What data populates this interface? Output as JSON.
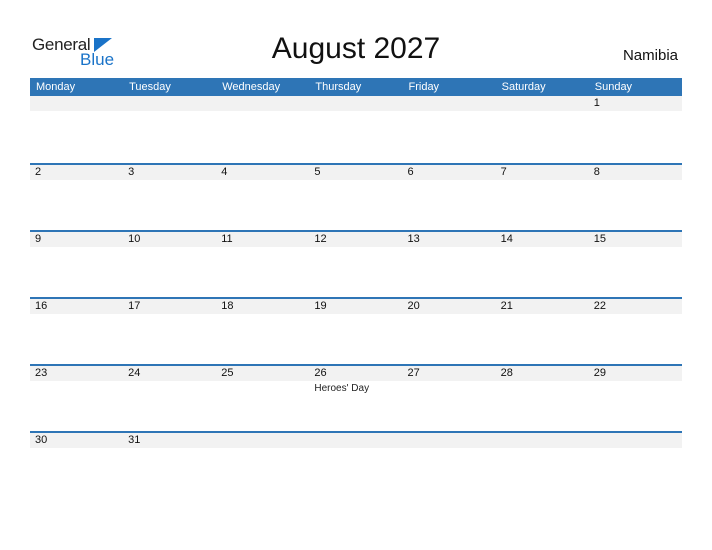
{
  "logo": {
    "word1": "General",
    "word2": "Blue"
  },
  "header": {
    "title": "August 2027",
    "country": "Namibia"
  },
  "colors": {
    "accent": "#2e75b6",
    "row_band": "#f2f2f2",
    "logo_blue": "#1a73c8"
  },
  "weekdays": [
    "Monday",
    "Tuesday",
    "Wednesday",
    "Thursday",
    "Friday",
    "Saturday",
    "Sunday"
  ],
  "weeks": [
    [
      {
        "day": ""
      },
      {
        "day": ""
      },
      {
        "day": ""
      },
      {
        "day": ""
      },
      {
        "day": ""
      },
      {
        "day": ""
      },
      {
        "day": "1"
      }
    ],
    [
      {
        "day": "2"
      },
      {
        "day": "3"
      },
      {
        "day": "4"
      },
      {
        "day": "5"
      },
      {
        "day": "6"
      },
      {
        "day": "7"
      },
      {
        "day": "8"
      }
    ],
    [
      {
        "day": "9"
      },
      {
        "day": "10"
      },
      {
        "day": "11"
      },
      {
        "day": "12"
      },
      {
        "day": "13"
      },
      {
        "day": "14"
      },
      {
        "day": "15"
      }
    ],
    [
      {
        "day": "16"
      },
      {
        "day": "17"
      },
      {
        "day": "18"
      },
      {
        "day": "19"
      },
      {
        "day": "20"
      },
      {
        "day": "21"
      },
      {
        "day": "22"
      }
    ],
    [
      {
        "day": "23"
      },
      {
        "day": "24"
      },
      {
        "day": "25"
      },
      {
        "day": "26",
        "holiday": "Heroes' Day"
      },
      {
        "day": "27"
      },
      {
        "day": "28"
      },
      {
        "day": "29"
      }
    ],
    [
      {
        "day": "30"
      },
      {
        "day": "31"
      },
      {
        "day": ""
      },
      {
        "day": ""
      },
      {
        "day": ""
      },
      {
        "day": ""
      },
      {
        "day": ""
      }
    ]
  ]
}
